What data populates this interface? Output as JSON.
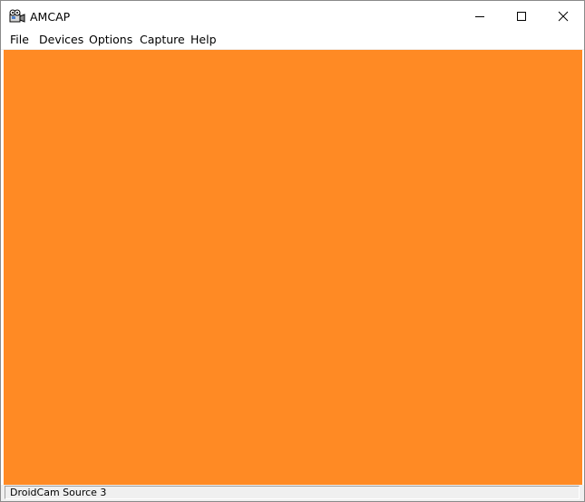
{
  "window": {
    "title": "AMCAP",
    "icon": "video-camera-icon"
  },
  "menu": {
    "items": [
      "File",
      "Devices",
      "Options",
      "Capture",
      "Help"
    ]
  },
  "preview": {
    "color": "#ff8a24"
  },
  "status": {
    "text": "DroidCam Source 3"
  }
}
